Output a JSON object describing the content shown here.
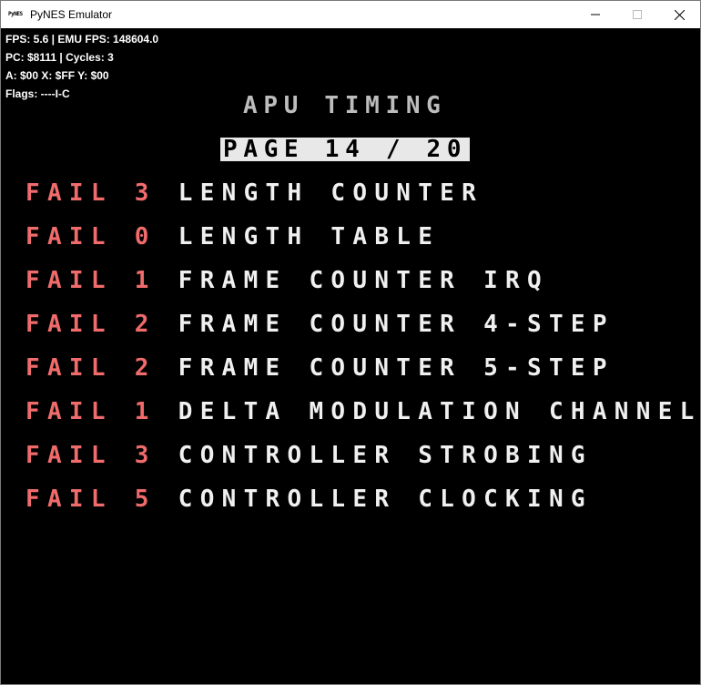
{
  "window": {
    "title": "PyNES Emulator",
    "icon_text": "PyNES"
  },
  "debug": {
    "line1": "FPS: 5.6 | EMU FPS: 148604.0",
    "line2": "PC: $8111 | Cycles: 3",
    "line3": "A: $00 X: $FF Y: $00",
    "line4": "Flags: ----I-C"
  },
  "screen": {
    "heading": "APU TIMING",
    "page_indicator": "PAGE 14 / 20",
    "results": [
      {
        "status": "FAIL",
        "code": "3",
        "name": "LENGTH COUNTER"
      },
      {
        "status": "FAIL",
        "code": "0",
        "name": "LENGTH TABLE"
      },
      {
        "status": "FAIL",
        "code": "1",
        "name": "FRAME COUNTER IRQ"
      },
      {
        "status": "FAIL",
        "code": "2",
        "name": "FRAME COUNTER 4-STEP"
      },
      {
        "status": "FAIL",
        "code": "2",
        "name": "FRAME COUNTER 5-STEP"
      },
      {
        "status": "FAIL",
        "code": "1",
        "name": "DELTA MODULATION CHANNEL"
      },
      {
        "status": "FAIL",
        "code": "3",
        "name": "CONTROLLER STROBING"
      },
      {
        "status": "FAIL",
        "code": "5",
        "name": "CONTROLLER CLOCKING"
      }
    ]
  },
  "colors": {
    "fail": "#f06b6b",
    "text": "#f0f0f0",
    "heading": "#bdbdbd",
    "background": "#000000"
  }
}
